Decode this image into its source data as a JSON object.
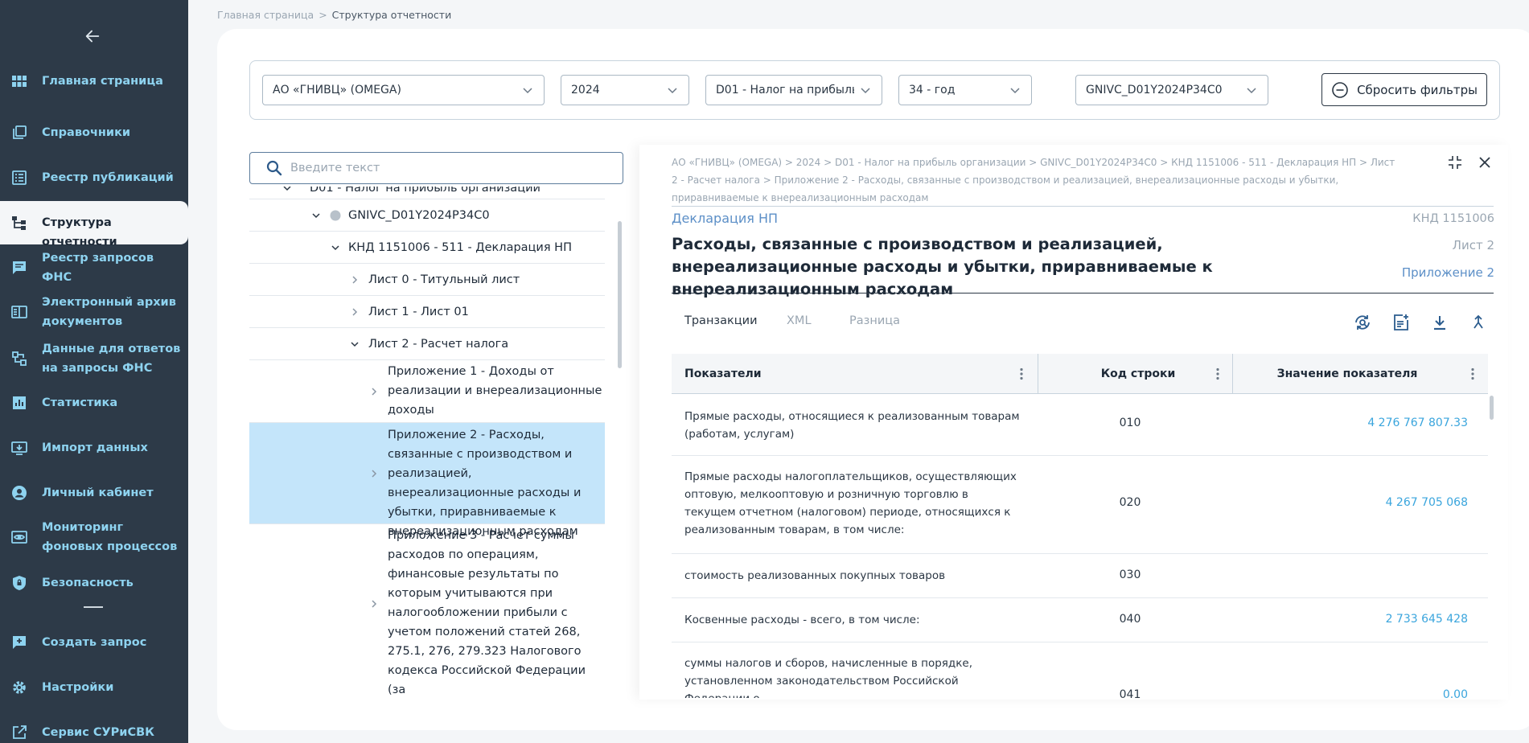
{
  "breadcrumb": {
    "home": "Главная страница",
    "separator": ">",
    "current": "Структура отчетности"
  },
  "sidebar": {
    "back_icon": "arrow-left-icon",
    "items": [
      {
        "label": "Главная страница",
        "icon": "grid-icon",
        "active": false
      },
      {
        "label": "Справочники",
        "icon": "books-icon",
        "active": false
      },
      {
        "label": "Реестр публикаций",
        "icon": "list-icon",
        "active": false
      },
      {
        "label": "Структура отчетности",
        "icon": "hierarchy-icon",
        "active": true
      },
      {
        "label": "Реестр запросов ФНС",
        "icon": "chat-icon",
        "active": false
      },
      {
        "label": "Электронный архив документов",
        "icon": "archive-icon",
        "active": false
      },
      {
        "label": "Данные для ответов на запросы ФНС",
        "icon": "data-icon",
        "active": false
      },
      {
        "label": "Статистика",
        "icon": "chart-icon",
        "active": false
      },
      {
        "label": "Импорт данных",
        "icon": "import-icon",
        "active": false
      },
      {
        "label": "Личный кабинет",
        "icon": "user-icon",
        "active": false
      },
      {
        "label": "Мониторинг фоновых процессов",
        "icon": "eye-icon",
        "active": false
      },
      {
        "label": "Безопасность",
        "icon": "shield-icon",
        "active": false
      },
      {
        "label": "Создать запрос",
        "icon": "add-box-icon",
        "active": false
      },
      {
        "label": "Настройки",
        "icon": "gear-icon",
        "active": false
      },
      {
        "label": "Сервис СУРиСВК",
        "icon": "external-link-icon",
        "active": false
      }
    ]
  },
  "filters": {
    "organization": "АО «ГНИВЦ» (OMEGA)",
    "year": "2024",
    "form": "D01 - Налог на прибыль...",
    "period": "34 - год",
    "code": "GNIVC_D01Y2024P34C0",
    "reset_label": "Сбросить фильтры"
  },
  "search": {
    "placeholder": "Введите текст"
  },
  "tree": {
    "nodes": [
      {
        "label": "D01 - Налог на прибыль организации"
      },
      {
        "label": "GNIVC_D01Y2024P34C0"
      },
      {
        "label": "КНД 1151006 - 511 - Декларация НП"
      },
      {
        "label": "Лист 0 - Титульный лист"
      },
      {
        "label": "Лист 1 - Лист 01"
      },
      {
        "label": "Лист 2 - Расчет налога"
      },
      {
        "label": "Приложение 1 - Доходы от реализации и внереализационные доходы"
      },
      {
        "label": "Приложение 2 - Расходы, связанные с производством и реализацией, внереализационные расходы и убытки, приравниваемые к внереализационным расходам"
      },
      {
        "label": "Приложение 3 - Расчет суммы расходов по операциям, финансовые результаты по которым учитываются при налогообложении прибыли с учетом положений статей 268, 275.1, 276, 279.323 Налогового кодекса Российской Федерации (за"
      }
    ]
  },
  "detail": {
    "path": "АО «ГНИВЦ» (OMEGA) > 2024 > D01 - Налог на прибыль организации > GNIVC_D01Y2024P34C0 > КНД 1151006 - 511 - Декларация НП > Лист 2 - Расчет налога > Приложение 2 - Расходы, связанные с производством и реализацией, внереализационные расходы и убытки, приравниваемые к внереализационным расходам",
    "form_name": "Декларация НП",
    "knd": "КНД 1151006",
    "title": "Расходы, связанные с производством и реализацией, внереализационные расходы и убытки, приравниваемые к внереализационным расходам",
    "sheet": "Лист 2",
    "appendix": "Приложение 2",
    "tabs": [
      {
        "label": "Транзакции",
        "active": true
      },
      {
        "label": "XML",
        "active": false
      },
      {
        "label": "Разница",
        "active": false
      }
    ],
    "actions": [
      "refresh-search-icon",
      "add-document-icon",
      "download-icon",
      "merge-icon"
    ]
  },
  "table": {
    "headers": [
      "Показатели",
      "Код строки",
      "Значение показателя"
    ],
    "rows": [
      {
        "name": "Прямые расходы, относящиеся к реализованным товарам (работам, услугам)",
        "code": "010",
        "value": "4 276 767 807.33"
      },
      {
        "name": "Прямые расходы налогоплательщиков, осуществляющих оптовую, мелкооптовую и розничную торговлю в текущем отчетном (налоговом) периоде, относящихся к реализованным товарам, в том числе:",
        "code": "020",
        "value": "4 267 705 068"
      },
      {
        "name": "стоимость реализованных покупных товаров",
        "code": "030",
        "value": ""
      },
      {
        "name": "Косвенные расходы - всего, в том числе:",
        "code": "040",
        "value": "2 733 645 428"
      },
      {
        "name": "суммы налогов и сборов, начисленные в порядке, установленном законодательством Российской Федерации о",
        "code": "041",
        "value": "0.00"
      }
    ]
  }
}
